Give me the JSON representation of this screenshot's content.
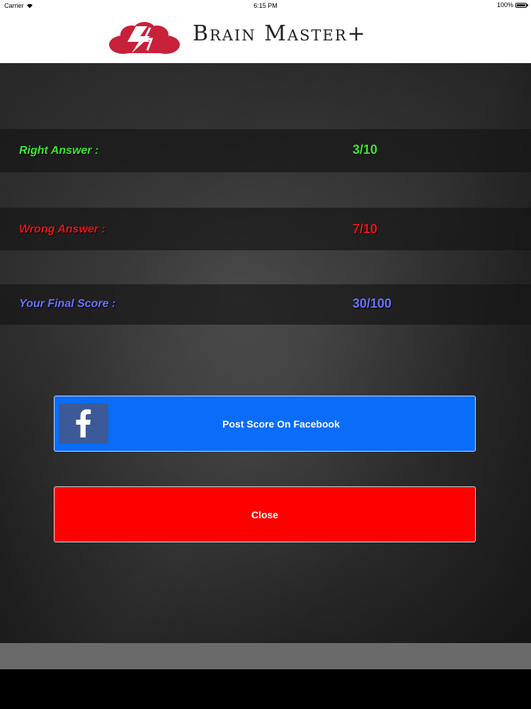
{
  "status_bar": {
    "carrier": "Carrier",
    "time": "6:15 PM",
    "battery": "100%"
  },
  "header": {
    "title": "Brain Master+"
  },
  "scores": {
    "right": {
      "label": "Right Answer :",
      "value": "3/10",
      "color": "#3fe62f"
    },
    "wrong": {
      "label": "Wrong Answer :",
      "value": "7/10",
      "color": "#e8151a"
    },
    "final": {
      "label": "Your Final Score :",
      "value": "30/100",
      "color": "#6b73ff"
    }
  },
  "buttons": {
    "facebook": {
      "label": "Post Score On Facebook",
      "icon": "facebook-icon",
      "color": "#0a6dfa"
    },
    "close": {
      "label": "Close",
      "color": "#fe0000"
    }
  }
}
